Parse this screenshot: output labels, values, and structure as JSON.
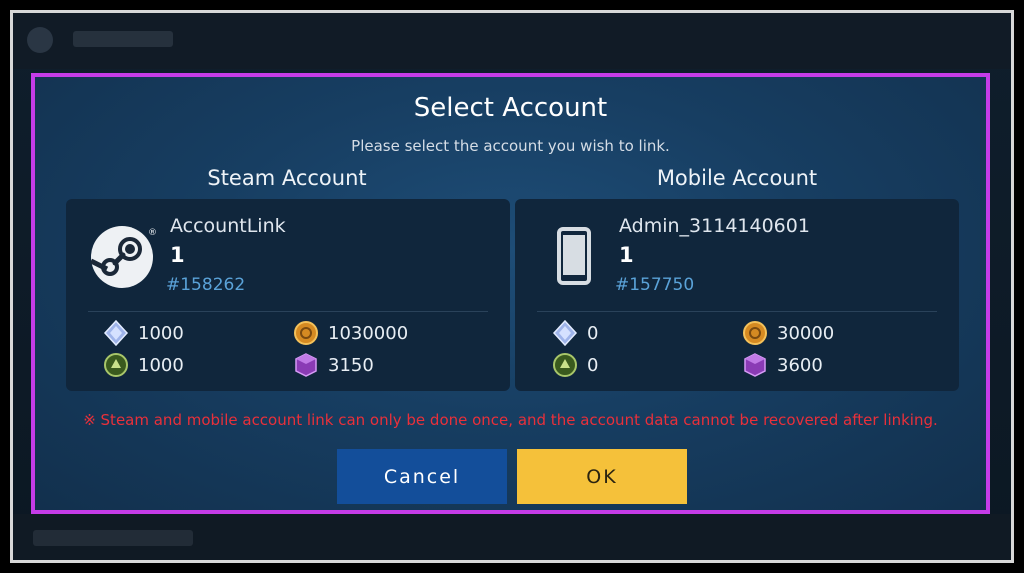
{
  "dialog": {
    "title": "Select Account",
    "subtitle": "Please select the account you wish to link.",
    "warning": "※ Steam and mobile account link can only be done once, and the account data cannot be recovered after linking.",
    "cancel_label": "Cancel",
    "ok_label": "OK"
  },
  "steam": {
    "header": "Steam Account",
    "name": "AccountLink",
    "level": "1",
    "id": "#158262",
    "icon": "steam-logo-icon",
    "resources": {
      "crystal": "1000",
      "coin": "1030000",
      "emblem": "1000",
      "cube": "3150"
    }
  },
  "mobile": {
    "header": "Mobile Account",
    "name": "Admin_3114140601",
    "level": "1",
    "id": "#157750",
    "icon": "phone-icon",
    "resources": {
      "crystal": "0",
      "coin": "30000",
      "emblem": "0",
      "cube": "3600"
    }
  },
  "colors": {
    "highlight_border": "#c53ce8",
    "warning": "#e9303a",
    "cancel_button": "#134e9a",
    "ok_button": "#f5c13a",
    "account_id": "#5aa2d8"
  }
}
